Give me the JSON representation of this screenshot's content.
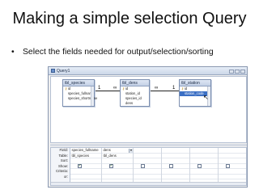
{
  "slide": {
    "title": "Making a simple selection Query",
    "bullet": "•",
    "bullet_text": "Select the fields needed for output/selection/sorting"
  },
  "window": {
    "title": "Query1"
  },
  "tables": [
    {
      "name": "tbl_species",
      "fields": [
        "id",
        "species_fullname",
        "species_shortname"
      ]
    },
    {
      "name": "tbl_dens",
      "fields": [
        "id",
        "station_id",
        "species_id",
        "dens"
      ]
    },
    {
      "name": "tbl_station",
      "fields": [
        "id",
        "station_code"
      ]
    }
  ],
  "grid": {
    "row_labels": [
      "Field:",
      "Table:",
      "Sort:",
      "Show:",
      "Criteria:",
      "or:"
    ],
    "columns": [
      {
        "field": "species_fullname",
        "table": "tbl_species",
        "show": true
      },
      {
        "field": "dens",
        "table": "tbl_dens",
        "show": true
      },
      {
        "field": "",
        "table": "",
        "show": false
      },
      {
        "field": "",
        "table": "",
        "show": false
      },
      {
        "field": "",
        "table": "",
        "show": false
      },
      {
        "field": "",
        "table": "",
        "show": false
      }
    ]
  },
  "relations": {
    "one_mark": "1",
    "many_mark": "∞"
  }
}
